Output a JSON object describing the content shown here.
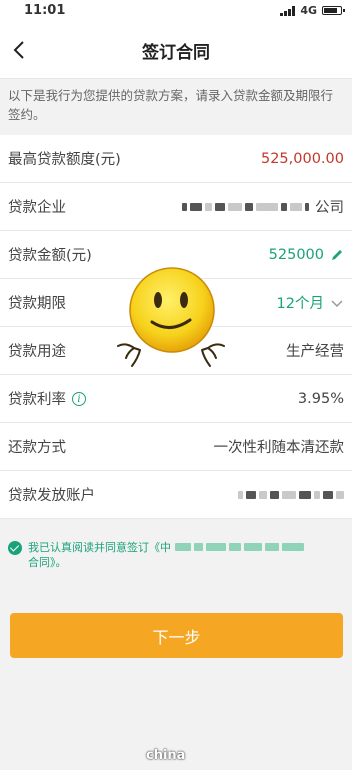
{
  "status_bar": {
    "time": "11:01",
    "network": "4G"
  },
  "nav": {
    "title": "签订合同"
  },
  "notice": "以下是我行为您提供的贷款方案，请录入贷款金额及期限行签约。",
  "rows": {
    "max_amount": {
      "label": "最高贷款额度(元)",
      "value": "525,000.00"
    },
    "company": {
      "label": "贷款企业",
      "value_suffix": "公司"
    },
    "amount": {
      "label": "贷款金额(元)",
      "value": "525000"
    },
    "term": {
      "label": "贷款期限",
      "value": "12个月"
    },
    "purpose": {
      "label": "贷款用途",
      "value": "生产经营"
    },
    "rate": {
      "label": "贷款利率",
      "value": "3.95%"
    },
    "repayment": {
      "label": "还款方式",
      "value": "一次性利随本清还款"
    },
    "account": {
      "label": "贷款发放账户"
    }
  },
  "agreement": {
    "text_prefix": "我已认真阅读并同意签订《中",
    "text_suffix": "合同》。"
  },
  "buttons": {
    "next": "下一步"
  },
  "watermark": "china",
  "colors": {
    "accent_green": "#1aa37a",
    "button_orange": "#f5a623",
    "amount_red": "#c0392b"
  },
  "icons": [
    "back-icon",
    "edit-pencil-icon",
    "dropdown-chevron-icon",
    "info-icon",
    "checkbox-checked-icon",
    "smiley-emoji"
  ]
}
